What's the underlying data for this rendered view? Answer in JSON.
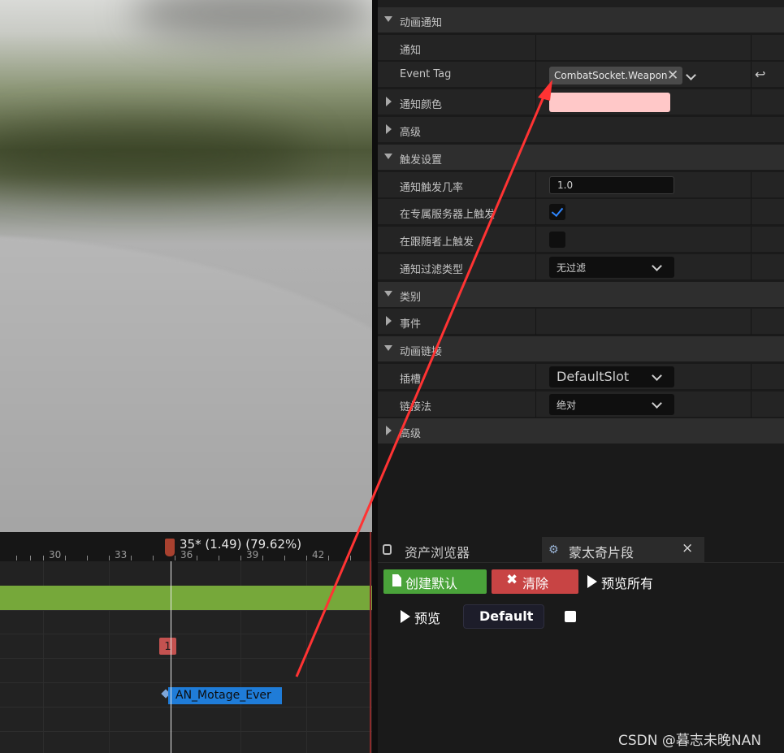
{
  "details": {
    "rows": [
      {
        "kind": "cat",
        "label": "动画通知",
        "expanded": true
      },
      {
        "kind": "prop",
        "label": "通知"
      },
      {
        "kind": "prop",
        "label": "Event Tag",
        "value": "CombatSocket.Weapon"
      },
      {
        "kind": "prop",
        "label": "通知颜色",
        "expandable": true,
        "color": "#ffc8c8"
      },
      {
        "kind": "prop",
        "label": "高级",
        "expandable": true
      },
      {
        "kind": "cat",
        "label": "触发设置",
        "expanded": true
      },
      {
        "kind": "prop",
        "label": "通知触发几率",
        "value": "1.0"
      },
      {
        "kind": "prop",
        "label": "在专属服务器上触发",
        "checked": true
      },
      {
        "kind": "prop",
        "label": "在跟随者上触发",
        "checked": false
      },
      {
        "kind": "prop",
        "label": "通知过滤类型",
        "value": "无过滤"
      },
      {
        "kind": "cat",
        "label": "类别",
        "expanded": true
      },
      {
        "kind": "prop",
        "label": "事件",
        "expandable": true
      },
      {
        "kind": "cat",
        "label": "动画链接",
        "expanded": true
      },
      {
        "kind": "prop",
        "label": "插槽",
        "value": "DefaultSlot"
      },
      {
        "kind": "prop",
        "label": "链接法",
        "value": "绝对"
      },
      {
        "kind": "cat",
        "label": "高级",
        "expandable": true
      }
    ]
  },
  "timeline": {
    "playhead_label": "35* (1.49) (79.62%)",
    "ticks": [
      "30",
      "33",
      "36",
      "39",
      "42"
    ],
    "track_marker": "1",
    "notify_label": "AN_Motage_Ever"
  },
  "montage_panel": {
    "tabs": [
      {
        "label": "资产浏览器",
        "icon": "asset-browser-icon"
      },
      {
        "label": "蒙太奇片段",
        "icon": "montage-sections-icon",
        "close": "×"
      }
    ],
    "buttons": {
      "create_default": "创建默认",
      "clear": "清除",
      "preview_all": "预览所有",
      "preview": "预览",
      "section": "Default"
    },
    "accent_green": "#4aa33a",
    "accent_red": "#c84444"
  },
  "watermark": "CSDN @暮志未晚NAN",
  "annotation_color": "#ff3333"
}
